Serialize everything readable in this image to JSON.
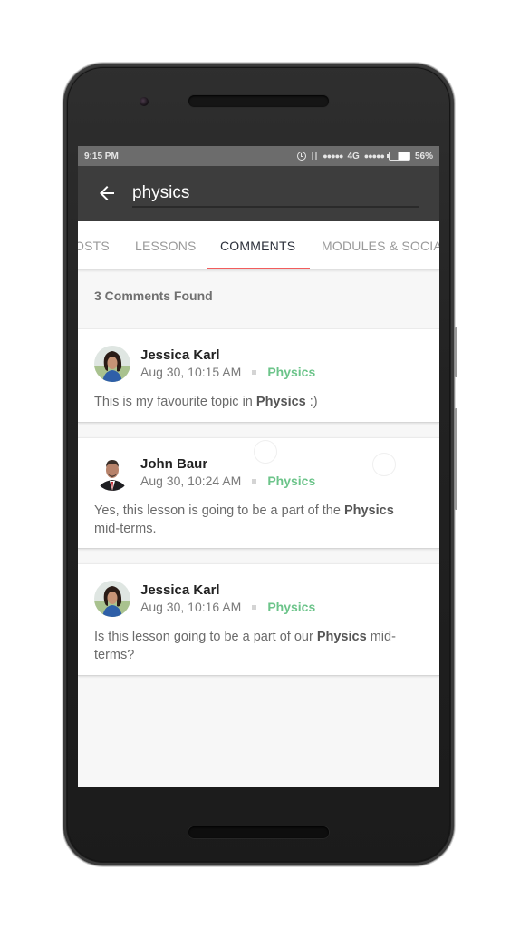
{
  "status_bar": {
    "time": "9:15 PM",
    "network": "4G",
    "signal_dots_1": "●●●●●",
    "signal_dots_2": "●●●●●",
    "battery": "56%",
    "battery_level_percent": 56,
    "icons": [
      "alarm-icon",
      "data-transfer-icon",
      "signal-icon",
      "battery-icon"
    ]
  },
  "app_bar": {
    "back_icon": "arrow-back-icon",
    "search_value": "physics"
  },
  "tabs": {
    "items": [
      {
        "label": "POSTS",
        "visible_text": "OSTS"
      },
      {
        "label": "LESSONS"
      },
      {
        "label": "COMMENTS",
        "active": true
      },
      {
        "label": "MODULES & SOCIAL",
        "visible_text": "MODULES & SOCIA"
      }
    ],
    "active_color": "#f25c5c"
  },
  "results": {
    "header": "3 Comments Found",
    "comments": [
      {
        "author": "Jessica Karl",
        "timestamp": "Aug 30, 10:15 AM",
        "topic": "Physics",
        "text_before": "This is my favourite topic in ",
        "text_highlight": "Physics",
        "text_after": " :)"
      },
      {
        "author": "John Baur",
        "timestamp": "Aug 30, 10:24 AM",
        "topic": "Physics",
        "text_before": "Yes, this lesson is going to be a part of the ",
        "text_highlight": "Physics",
        "text_after": " mid-terms."
      },
      {
        "author": "Jessica Karl",
        "timestamp": "Aug 30, 10:16 AM",
        "topic": "Physics",
        "text_before": "Is this lesson going to be a part of our ",
        "text_highlight": "Physics",
        "text_after": " mid-terms?"
      }
    ]
  },
  "colors": {
    "topic_green": "#6cc48a",
    "app_bar": "#3d3d3d",
    "status_bar": "#6c6c6c",
    "tab_indicator": "#f25c5c"
  }
}
